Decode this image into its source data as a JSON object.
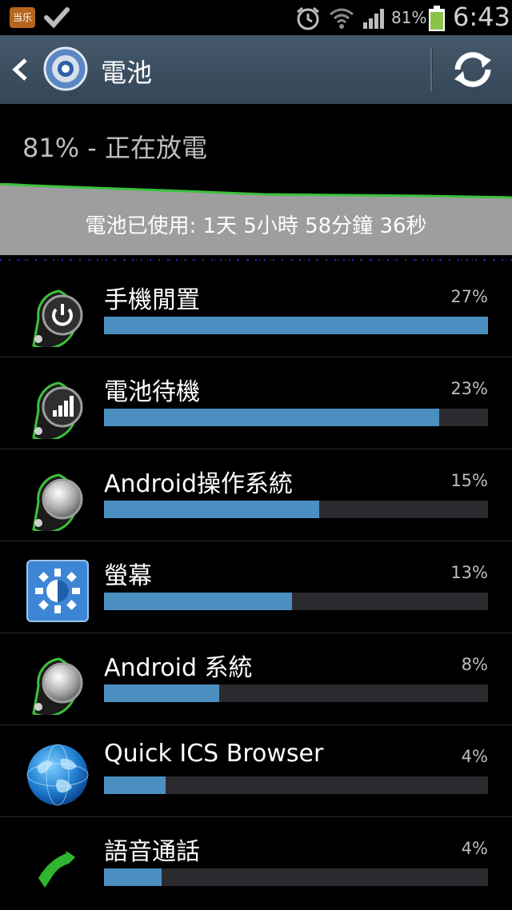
{
  "status_bar": {
    "app_badge": "当乐",
    "battery_pct": "81%",
    "time": "6:43"
  },
  "action_bar": {
    "title": "電池"
  },
  "battery": {
    "status_text": "81% - 正在放電",
    "usage_time": "電池已使用: 1天 5小時 58分鐘 36秒"
  },
  "usage": [
    {
      "name": "手機閒置",
      "percent": "27%",
      "fraction": 1.0,
      "icon": "power-icon"
    },
    {
      "name": "電池待機",
      "percent": "23%",
      "fraction": 0.873,
      "icon": "signal-icon"
    },
    {
      "name": "Android操作系統",
      "percent": "15%",
      "fraction": 0.56,
      "icon": "android-os-icon"
    },
    {
      "name": "螢幕",
      "percent": "13%",
      "fraction": 0.49,
      "icon": "brightness-icon"
    },
    {
      "name": "Android 系統",
      "percent": "8%",
      "fraction": 0.3,
      "icon": "android-system-icon"
    },
    {
      "name": "Quick ICS Browser",
      "percent": "4%",
      "fraction": 0.16,
      "icon": "globe-icon"
    },
    {
      "name": "語音通話",
      "percent": "4%",
      "fraction": 0.15,
      "icon": "phone-icon"
    }
  ],
  "colors": {
    "bar": "#4b8fc1",
    "track": "#2b2b2f",
    "graph_line": "#3bc23b",
    "action_bar": "#3c5062"
  }
}
